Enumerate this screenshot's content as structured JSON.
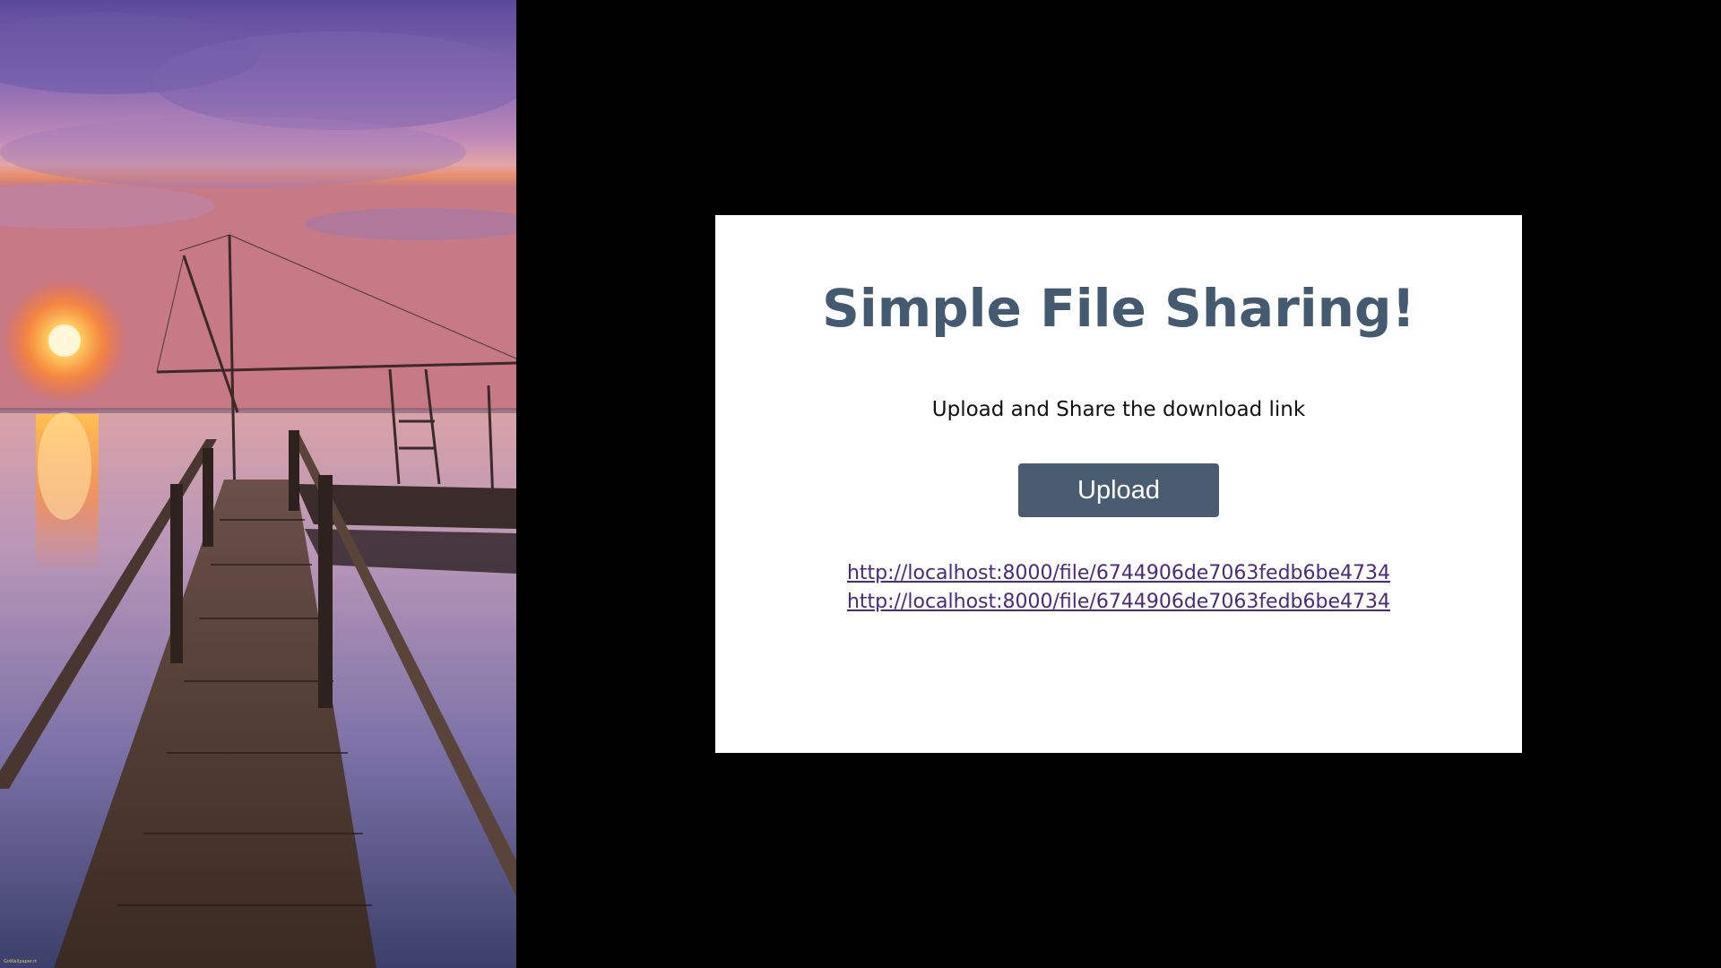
{
  "hero": {
    "image_alt": "Sunset over a lagoon with a wooden pier",
    "credit": "GoWallpaper.rt"
  },
  "card": {
    "title": "Simple File Sharing!",
    "subtitle": "Upload and Share the download link",
    "upload_label": "Upload",
    "links": [
      {
        "text": "http://localhost:8000/file/6744906de7063fedb6be4734"
      },
      {
        "text": "http://localhost:8000/file/6744906de7063fedb6be4734"
      }
    ]
  },
  "colors": {
    "page_background": "#000000",
    "card_background": "#ffffff",
    "title": "#435a70",
    "button": "#4a5c70",
    "link": "#4b2a7c"
  }
}
